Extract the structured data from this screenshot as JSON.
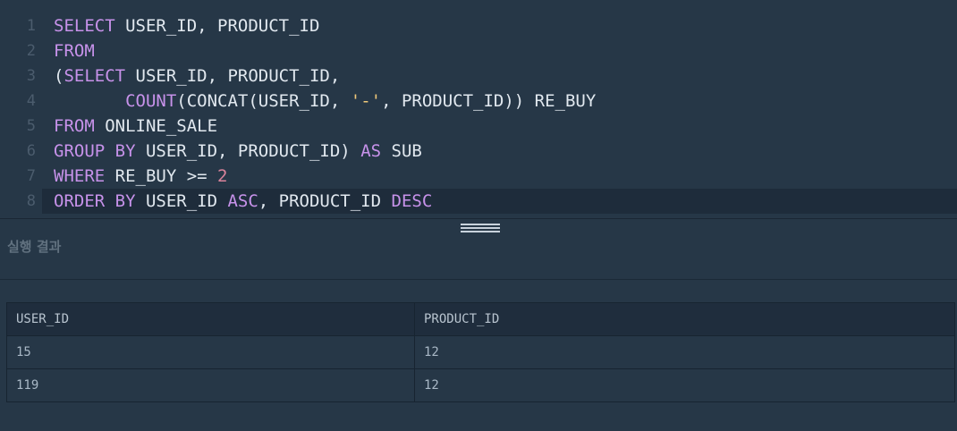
{
  "editor": {
    "lines": [
      {
        "num": "1",
        "tokens": [
          {
            "t": "SELECT",
            "c": "kw"
          },
          {
            "t": " USER_ID, PRODUCT_ID",
            "c": "p"
          }
        ]
      },
      {
        "num": "2",
        "tokens": [
          {
            "t": "FROM",
            "c": "kw"
          }
        ]
      },
      {
        "num": "3",
        "tokens": [
          {
            "t": "(",
            "c": "p"
          },
          {
            "t": "SELECT",
            "c": "kw"
          },
          {
            "t": " USER_ID, PRODUCT_ID,",
            "c": "p"
          }
        ]
      },
      {
        "num": "4",
        "tokens": [
          {
            "t": "       ",
            "c": "p"
          },
          {
            "t": "COUNT",
            "c": "kw"
          },
          {
            "t": "(CONCAT(USER_ID, ",
            "c": "p"
          },
          {
            "t": "'-'",
            "c": "str"
          },
          {
            "t": ", PRODUCT_ID)) RE_BUY",
            "c": "p"
          }
        ]
      },
      {
        "num": "5",
        "tokens": [
          {
            "t": "FROM",
            "c": "kw"
          },
          {
            "t": " ONLINE_SALE",
            "c": "p"
          }
        ]
      },
      {
        "num": "6",
        "tokens": [
          {
            "t": "GROUP BY",
            "c": "kw"
          },
          {
            "t": " USER_ID, PRODUCT_ID) ",
            "c": "p"
          },
          {
            "t": "AS",
            "c": "kw"
          },
          {
            "t": " SUB",
            "c": "p"
          }
        ]
      },
      {
        "num": "7",
        "tokens": [
          {
            "t": "WHERE",
            "c": "kw"
          },
          {
            "t": " RE_BUY >= ",
            "c": "p"
          },
          {
            "t": "2",
            "c": "num"
          }
        ]
      },
      {
        "num": "8",
        "active": true,
        "tokens": [
          {
            "t": "ORDER BY",
            "c": "kw"
          },
          {
            "t": " USER_ID ",
            "c": "p"
          },
          {
            "t": "ASC",
            "c": "kw"
          },
          {
            "t": ", PRODUCT_ID ",
            "c": "p"
          },
          {
            "t": "DESC",
            "c": "kw"
          }
        ]
      }
    ]
  },
  "results": {
    "title": "실행 결과",
    "columns": [
      "USER_ID",
      "PRODUCT_ID"
    ],
    "rows": [
      [
        "15",
        "12"
      ],
      [
        "119",
        "12"
      ]
    ]
  },
  "icons": {
    "resize": "drag-handle-icon"
  },
  "colors": {
    "background": "#263747",
    "keyword": "#c792ea",
    "string": "#f0c97a",
    "number": "#d9839b",
    "text": "#e1e8ef"
  }
}
